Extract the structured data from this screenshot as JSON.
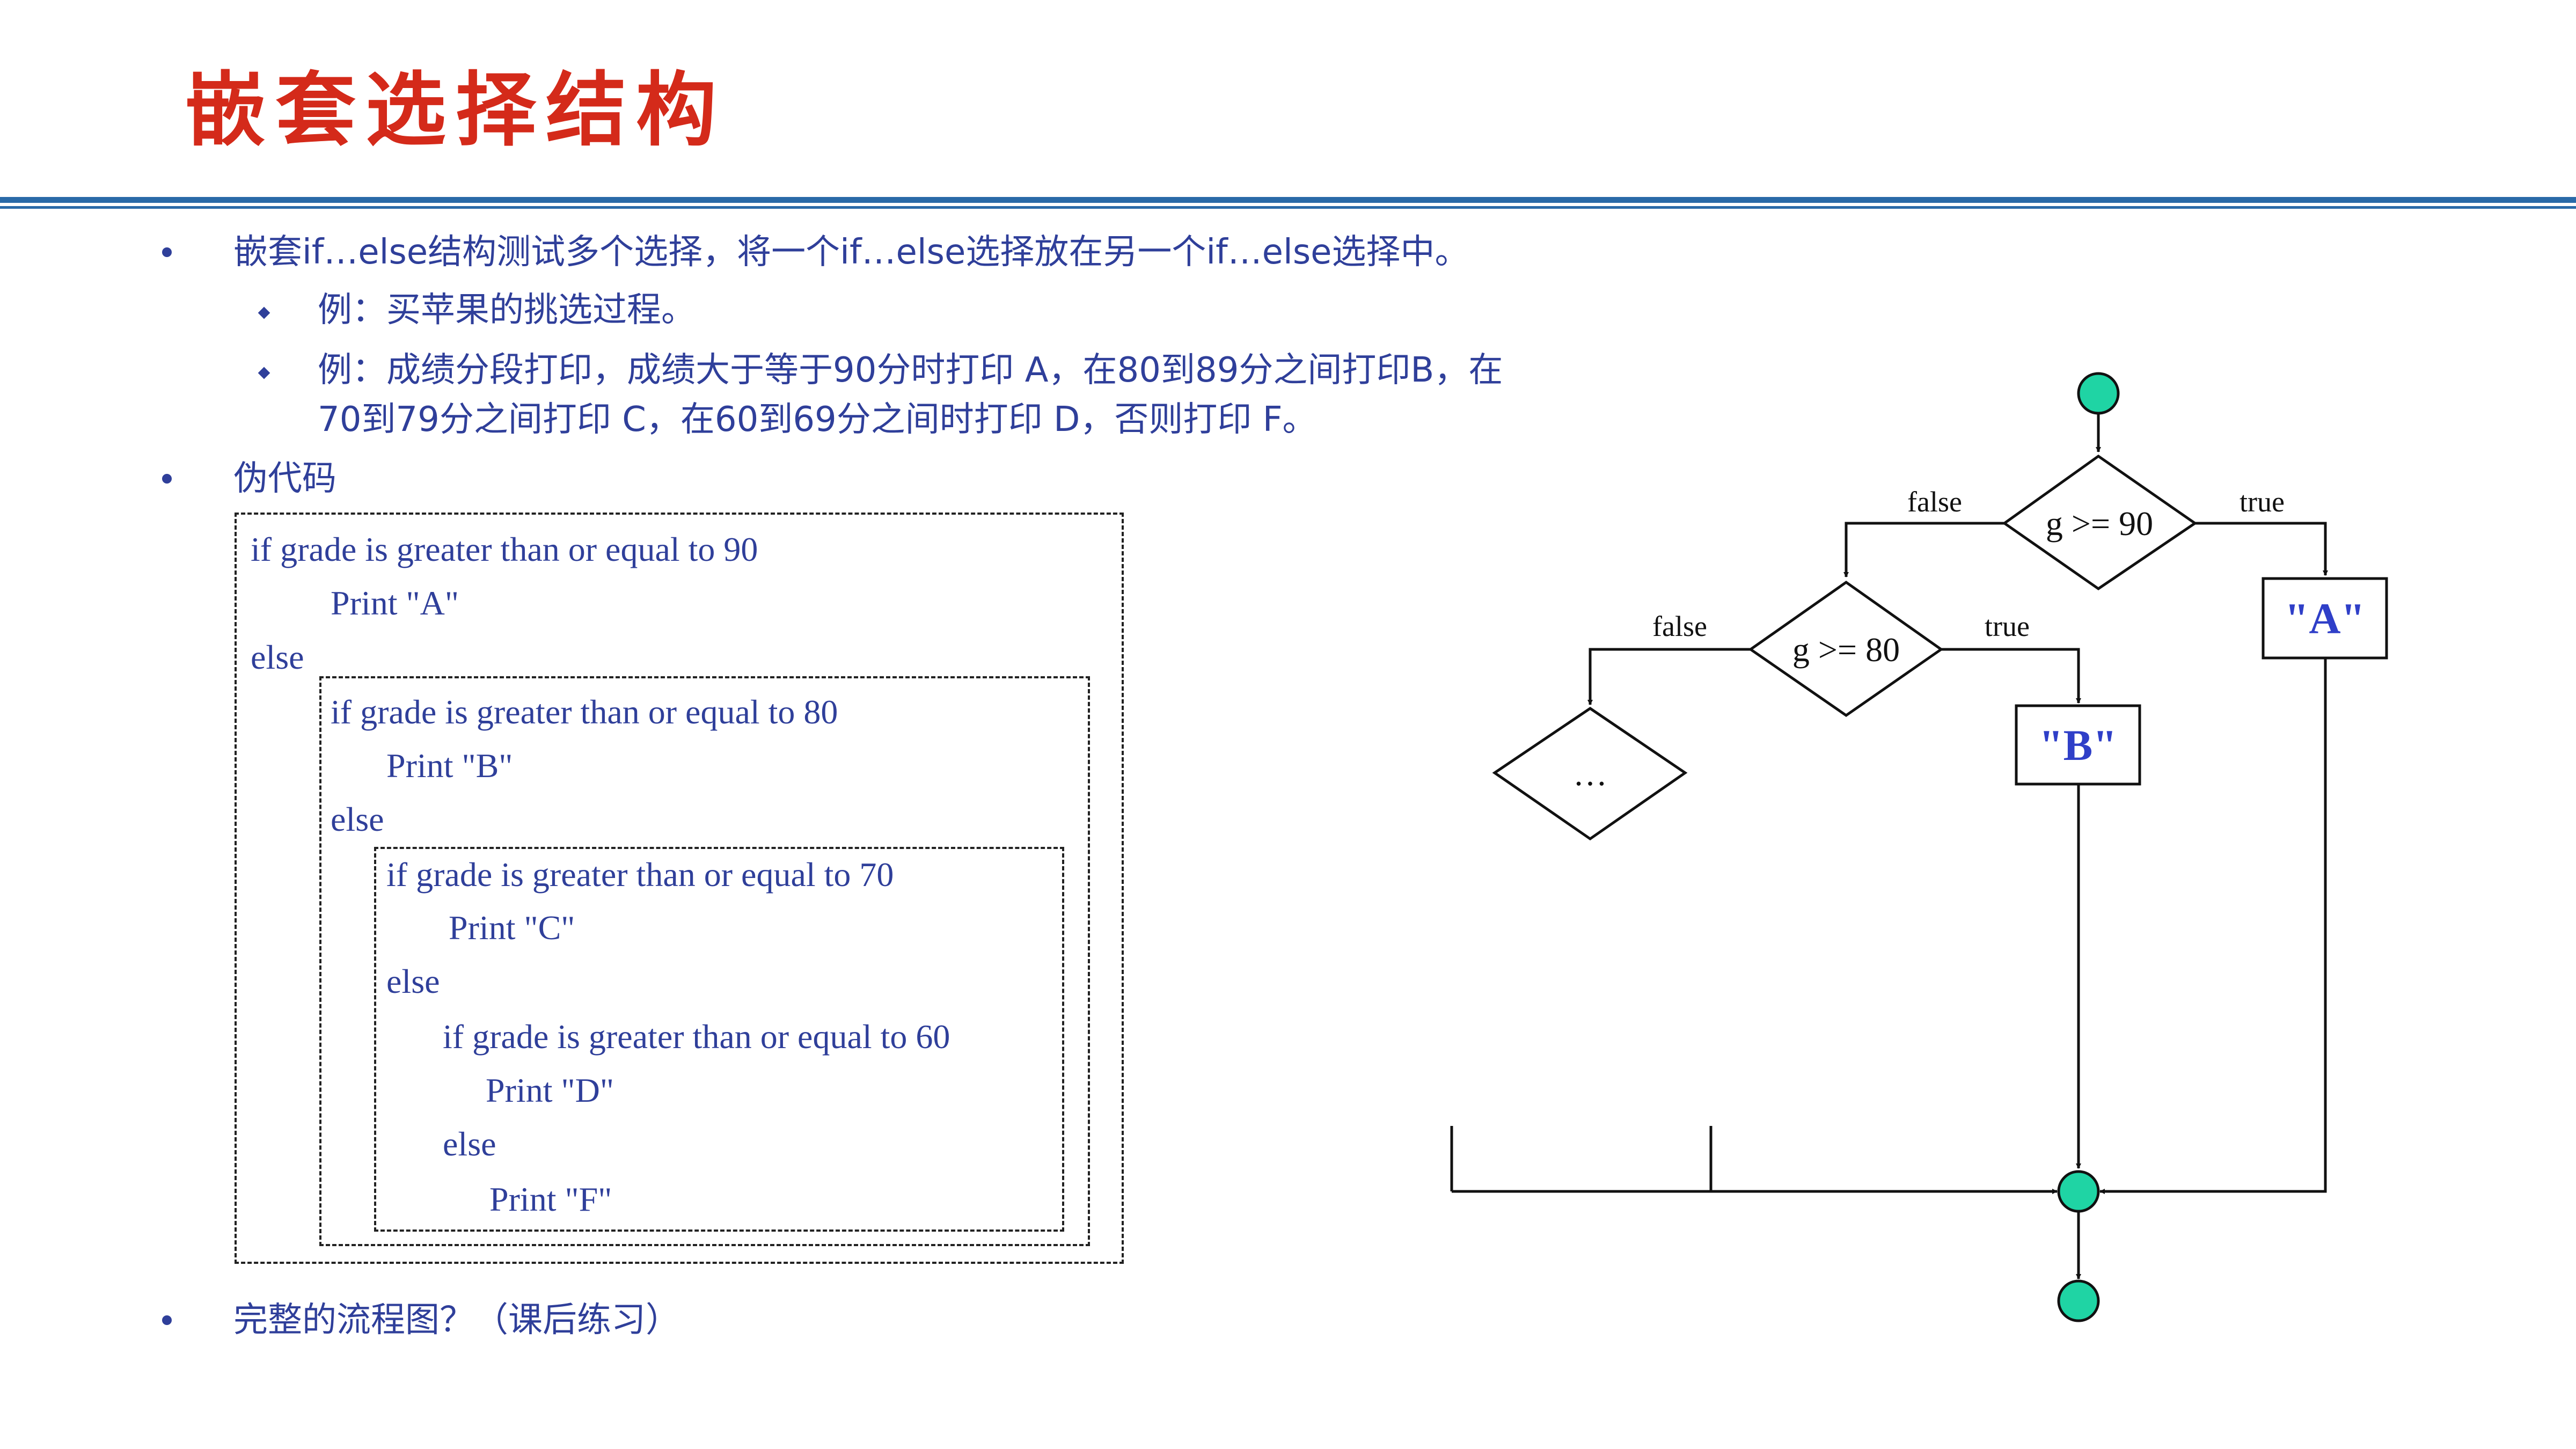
{
  "title": "嵌套选择结构",
  "bullets": {
    "b1": "嵌套if…else结构测试多个选择，将一个if…else选择放在另一个if…else选择中。",
    "b1_sub1": "例：买苹果的挑选过程。",
    "b1_sub2_line1": "例：成绩分段打印，成绩大于等于90分时打印 A，在80到89分之间打印B，在",
    "b1_sub2_line2": "70到79分之间打印 C，在60到69分之间时打印 D，否则打印 F。",
    "b2": "伪代码",
    "b3": "完整的流程图？（课后练习）"
  },
  "pseudocode": {
    "l1": "if grade is greater than or equal to 90",
    "l2": "Print \"A\"",
    "l3": "else",
    "l4": "if grade is greater than or equal to 80",
    "l5": "Print \"B\"",
    "l6": "else",
    "l7": "if grade is greater than or equal to 70",
    "l8": "Print \"C\"",
    "l9": "else",
    "l10": "if grade is greater than or equal to 60",
    "l11": "Print \"D\"",
    "l12": "else",
    "l13": "Print \"F\""
  },
  "flowchart": {
    "cond1": "g >= 90",
    "cond2": "g >= 80",
    "cond3": "…",
    "false1": "false",
    "true1": "true",
    "false2": "false",
    "true2": "true",
    "out_a": "\"A\"",
    "out_b": "\"B\"",
    "node_color": "#1fd4a4",
    "output_text_color": "#2f3fc8"
  }
}
